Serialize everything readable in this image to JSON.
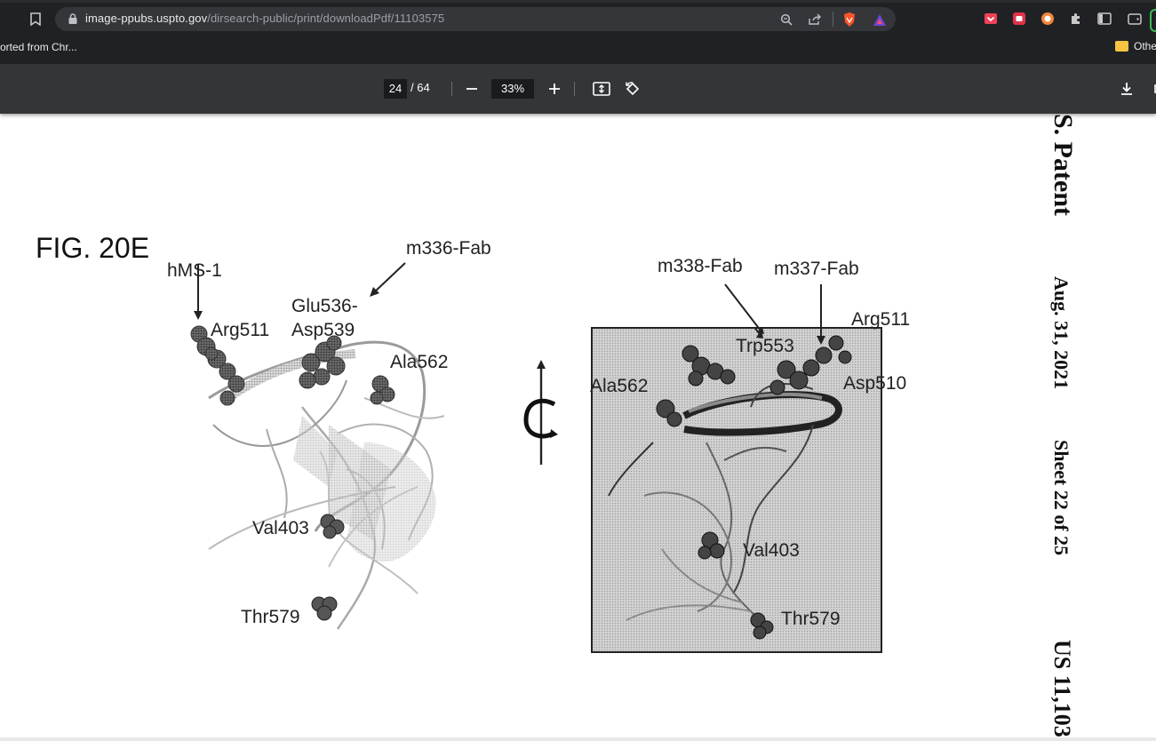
{
  "browser": {
    "url_host": "image-ppubs.uspto.gov",
    "url_path": "/dirsearch-public/print/downloadPdf/11103575",
    "bookmarks_left": "orted from Chr...",
    "bookmarks_right": "Othe"
  },
  "pdf_toolbar": {
    "page_current": "24",
    "page_total": "/ 64",
    "zoom": "33%"
  },
  "figure": {
    "title": "FIG. 20E",
    "left_labels": {
      "hms1": "hMS-1",
      "m336": "m336-Fab",
      "glu536": "Glu536-",
      "asp539": "Asp539",
      "arg511": "Arg511",
      "ala562": "Ala562",
      "val403": "Val403",
      "thr579": "Thr579"
    },
    "right_labels": {
      "m338": "m338-Fab",
      "m337": "m337-Fab",
      "arg511": "Arg511",
      "trp553": "Trp553",
      "ala562": "Ala562",
      "asp510": "Asp510",
      "val403": "Val403",
      "thr579": "Thr579"
    }
  },
  "margin_text": {
    "patent": "S. Patent",
    "date": "Aug. 31, 2021",
    "sheet": "Sheet 22 of 25",
    "number": "US 11,103"
  }
}
